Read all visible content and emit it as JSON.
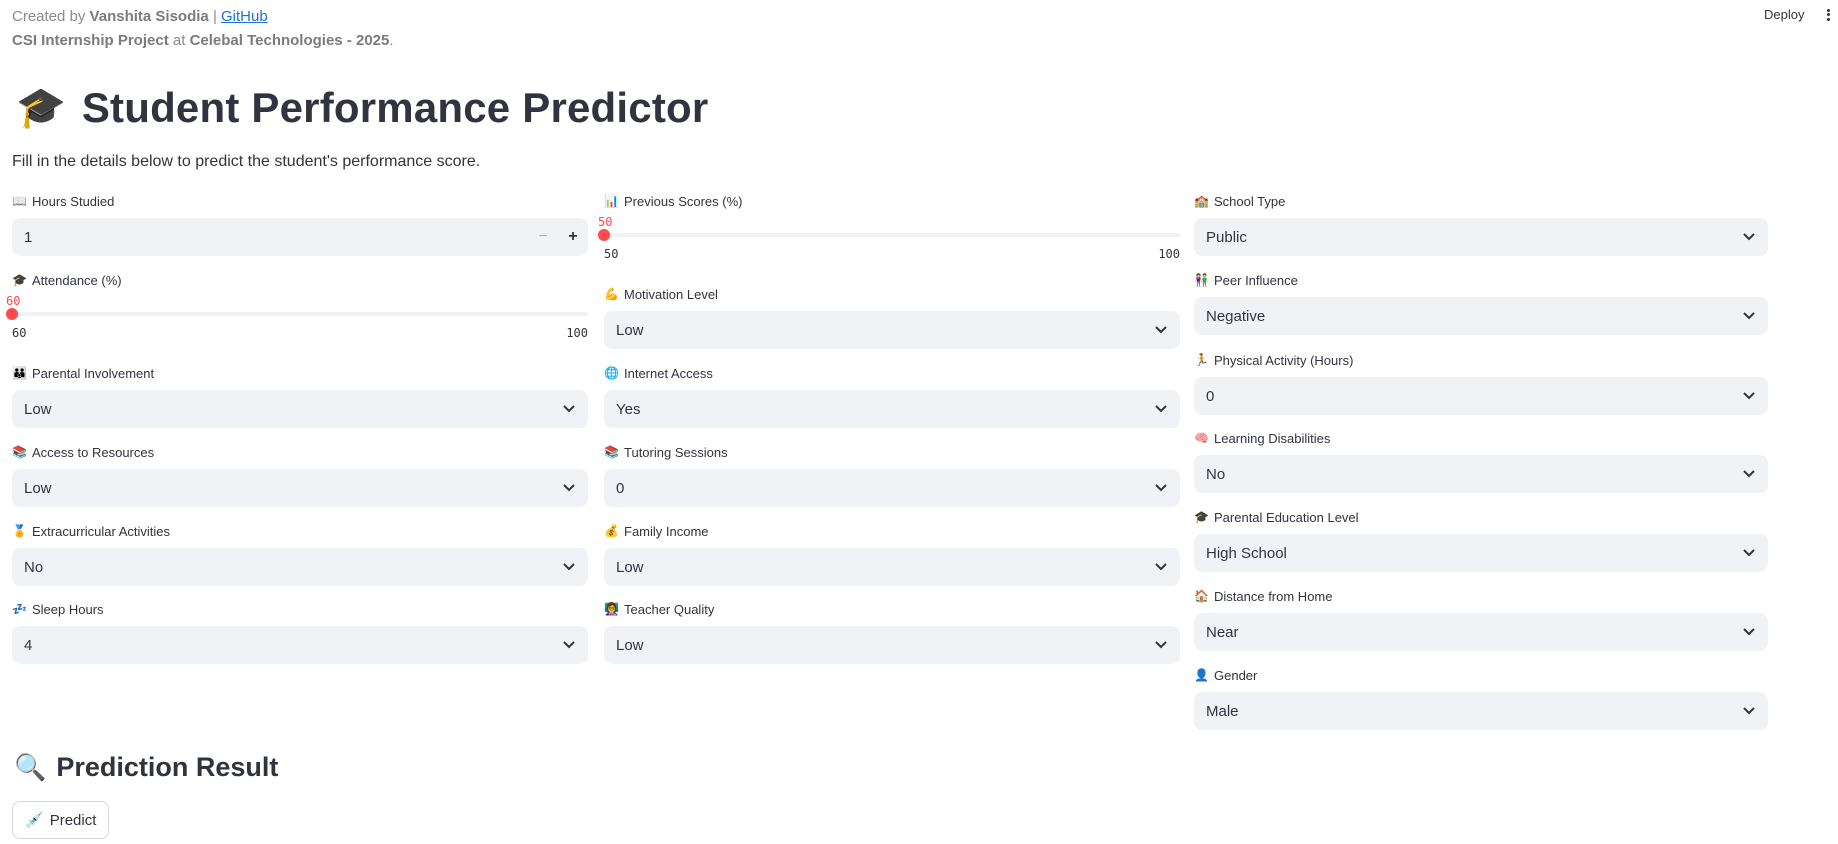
{
  "header": {
    "created_by_prefix": "Created by",
    "author": "Vanshita Sisodia",
    "separator": "|",
    "github_link": "GitHub",
    "project": "CSI Internship Project",
    "at_word": "at",
    "company": "Celebal Technologies - 2025",
    "period": "."
  },
  "toolbar": {
    "deploy_label": "Deploy",
    "menu_icon": "kebab-menu-icon"
  },
  "title": {
    "emoji": "🎓",
    "text": "Student Performance Predictor"
  },
  "subtitle": "Fill in the details below to predict the student's performance score.",
  "fields": {
    "hours_studied": {
      "icon": "📖",
      "label": "Hours Studied",
      "value": "1",
      "minus": "−",
      "plus": "+"
    },
    "attendance": {
      "icon": "🎓",
      "label": "Attendance (%)",
      "current": "60",
      "min": "60",
      "max": "100"
    },
    "parental_involvement": {
      "icon": "👪",
      "label": "Parental Involvement",
      "value": "Low"
    },
    "access_to_resources": {
      "icon": "📚",
      "label": "Access to Resources",
      "value": "Low"
    },
    "extracurricular": {
      "icon": "🏅",
      "label": "Extracurricular Activities",
      "value": "No"
    },
    "sleep_hours": {
      "icon": "💤",
      "label": "Sleep Hours",
      "value": "4"
    },
    "previous_scores": {
      "icon": "📊",
      "label": "Previous Scores (%)",
      "current": "50",
      "min": "50",
      "max": "100"
    },
    "motivation": {
      "icon": "💪",
      "label": "Motivation Level",
      "value": "Low"
    },
    "internet_access": {
      "icon": "🌐",
      "label": "Internet Access",
      "value": "Yes"
    },
    "tutoring": {
      "icon": "📚",
      "label": "Tutoring Sessions",
      "value": "0"
    },
    "family_income": {
      "icon": "💰",
      "label": "Family Income",
      "value": "Low"
    },
    "teacher_quality": {
      "icon": "👩‍🏫",
      "label": "Teacher Quality",
      "value": "Low"
    },
    "school_type": {
      "icon": "🏫",
      "label": "School Type",
      "value": "Public"
    },
    "peer_influence": {
      "icon": "👫",
      "label": "Peer Influence",
      "value": "Negative"
    },
    "physical_activity": {
      "icon": "🏃",
      "label": "Physical Activity (Hours)",
      "value": "0"
    },
    "learning_disabilities": {
      "icon": "🧠",
      "label": "Learning Disabilities",
      "value": "No"
    },
    "parental_education": {
      "icon": "🎓",
      "label": "Parental Education Level",
      "value": "High School"
    },
    "distance": {
      "icon": "🏠",
      "label": "Distance from Home",
      "value": "Near"
    },
    "gender": {
      "icon": "👤",
      "label": "Gender",
      "value": "Male"
    }
  },
  "result": {
    "emoji": "🔍",
    "title": "Prediction Result",
    "button_icon": "💉",
    "button_label": "Predict"
  },
  "colors": {
    "accent": "#ff4b4b",
    "input_bg": "#f0f2f6",
    "text": "#31333f",
    "link": "#1f6fd1"
  }
}
